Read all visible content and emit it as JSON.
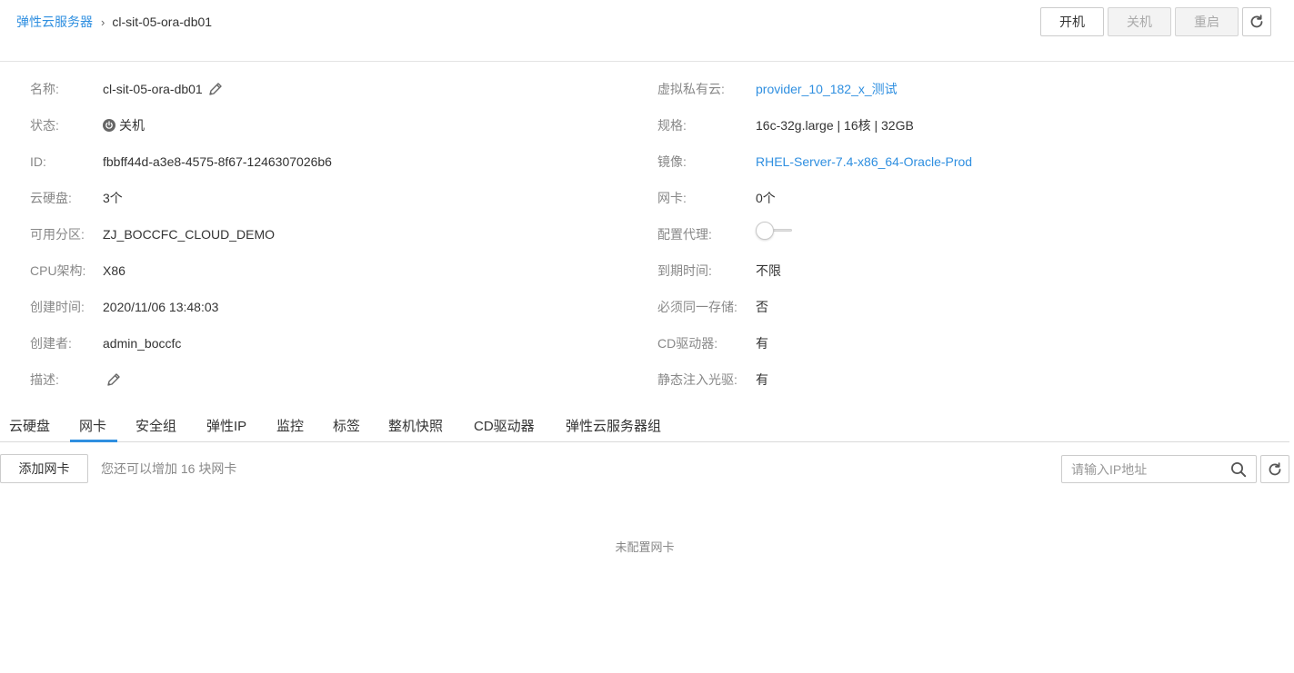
{
  "breadcrumb": {
    "parent": "弹性云服务器",
    "separator": "›",
    "current": "cl-sit-05-ora-db01"
  },
  "actions": {
    "start": "开机",
    "stop": "关机",
    "restart": "重启",
    "refresh_icon": "refresh-icon"
  },
  "details_left": [
    {
      "label": "名称:",
      "value": "cl-sit-05-ora-db01"
    },
    {
      "label": "状态:",
      "value": "关机"
    },
    {
      "label": "ID:",
      "value": "fbbff44d-a3e8-4575-8f67-1246307026b6"
    },
    {
      "label": "云硬盘:",
      "value": "3个"
    },
    {
      "label": "可用分区:",
      "value": "ZJ_BOCCFC_CLOUD_DEMO"
    },
    {
      "label": "CPU架构:",
      "value": "X86"
    },
    {
      "label": "创建时间:",
      "value": "2020/11/06 13:48:03"
    },
    {
      "label": "创建者:",
      "value": "admin_boccfc"
    },
    {
      "label": "描述:",
      "value": ""
    }
  ],
  "details_right": [
    {
      "label": "虚拟私有云:",
      "value": "provider_10_182_x_测试"
    },
    {
      "label": "规格:",
      "value": "16c-32g.large | 16核 | 32GB"
    },
    {
      "label": "镜像:",
      "value": "RHEL-Server-7.4-x86_64-Oracle-Prod"
    },
    {
      "label": "网卡:",
      "value": "0个"
    },
    {
      "label": "配置代理:",
      "value": ""
    },
    {
      "label": "到期时间:",
      "value": "不限"
    },
    {
      "label": "必须同一存储:",
      "value": "否"
    },
    {
      "label": "CD驱动器:",
      "value": "有"
    },
    {
      "label": "静态注入光驱:",
      "value": "有"
    }
  ],
  "proxy_toggle": {
    "on": false
  },
  "tabs": [
    "云硬盘",
    "网卡",
    "安全组",
    "弹性IP",
    "监控",
    "标签",
    "整机快照",
    "CD驱动器",
    "弹性云服务器组"
  ],
  "active_tab": "网卡",
  "nic_panel": {
    "add_button": "添加网卡",
    "hint": "您还可以增加 16 块网卡",
    "search_placeholder": "请输入IP地址",
    "empty_text": "未配置网卡"
  },
  "colors": {
    "accent": "#2f8fe0",
    "label": "#888888",
    "text": "#333333"
  }
}
